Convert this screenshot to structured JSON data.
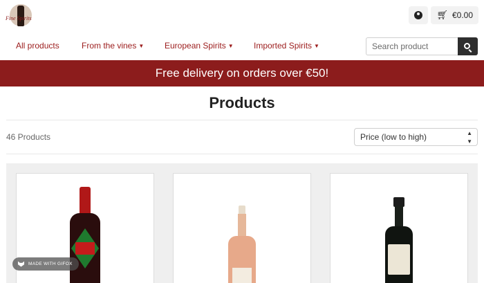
{
  "header": {
    "logo_text": "Fine Spirits",
    "cart_total": "€0.00",
    "icons": {
      "account": "user-circle-icon",
      "cart": "shopping-cart-icon"
    }
  },
  "nav": {
    "items": [
      {
        "label": "All products",
        "has_dropdown": false
      },
      {
        "label": "From the vines",
        "has_dropdown": true
      },
      {
        "label": "European Spirits",
        "has_dropdown": true
      },
      {
        "label": "Imported Spirits",
        "has_dropdown": true
      }
    ],
    "search_placeholder": "Search product"
  },
  "banner": {
    "text": "Free delivery on orders over €50!"
  },
  "listing": {
    "title": "Products",
    "count": "46 Products",
    "sort_selected": "Price (low to high)"
  },
  "overlay": {
    "gifox_label": "MADE WITH GIFOX"
  },
  "colors": {
    "brand": "#8c1c1c",
    "nav_text": "#9b1b1b",
    "grid_bg": "#efefef"
  }
}
